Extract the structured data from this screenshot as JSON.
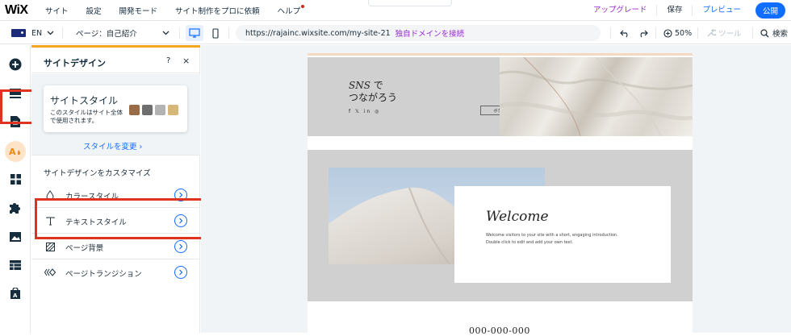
{
  "topbar": {
    "logo": "WiX",
    "menu": [
      "サイト",
      "設定",
      "開発モード",
      "サイト制作をプロに依頼",
      "ヘルプ"
    ],
    "upgrade": "アップグレード",
    "save": "保存",
    "preview": "プレビュー",
    "publish": "公開"
  },
  "toolbar": {
    "language": "EN",
    "page_label": "ページ：自己紹介",
    "url": "https://rajainc.wixsite.com/my-site-21",
    "connect_domain": "独自ドメインを接続",
    "zoom": "50%",
    "tools": "ツール",
    "search": "検索"
  },
  "panel": {
    "title": "サイトデザイン",
    "help": "?",
    "close": "×",
    "style_card": {
      "title": "サイトスタイル",
      "description": "このスタイルはサイト全体で使用されます。",
      "swatches": [
        "#9a6b47",
        "#6e6e6e",
        "#b3b3b3",
        "#d6b679"
      ]
    },
    "change_style": "スタイルを変更 ›",
    "customize_label": "サイトデザインをカスタマイズ",
    "options": [
      {
        "label": "カラースタイル",
        "icon": "drop-icon"
      },
      {
        "label": "テキストスタイル",
        "icon": "text-icon"
      },
      {
        "label": "ページ背景",
        "icon": "background-icon"
      },
      {
        "label": "ページトランジション",
        "icon": "transition-icon"
      }
    ]
  },
  "site": {
    "hero_title_line1_italic": "SNS",
    "hero_title_line1_rest": " で",
    "hero_title_line2": "つながろう",
    "social": "f 𝕏 in ◎",
    "hero_button": "ボタン",
    "welcome_title": "Welcome",
    "welcome_text": "Welcome visitors to your site with a short, engaging introduction. Double click to edit and add your own text.",
    "phone": "000-000-000"
  },
  "colors": {
    "accent_blue": "#116dff",
    "upgrade_purple": "#9a27d5",
    "highlight_red": "#e0331f",
    "panel_accent": "#f5a623"
  }
}
